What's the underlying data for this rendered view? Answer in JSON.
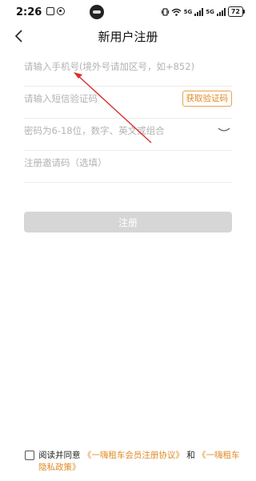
{
  "status_bar": {
    "time": "2:26",
    "network_label_1": "5G",
    "network_label_2": "5G",
    "battery": "72"
  },
  "header": {
    "title": "新用户注册"
  },
  "form": {
    "phone_placeholder": "请输入手机号(境外号请加区号，如+852)",
    "sms_placeholder": "请输入短信验证码",
    "sms_button": "获取验证码",
    "password_placeholder": "密码为6-18位，数字、英文或组合",
    "invite_placeholder": "注册邀请码（选填）"
  },
  "submit": {
    "label": "注册"
  },
  "agreement": {
    "prefix": "阅读并同意",
    "member_agreement": "《一嗨租车会员注册协议》",
    "conjunction": "和",
    "privacy_policy": "《一嗨租车隐私政策》"
  },
  "colors": {
    "accent": "#e08a26",
    "button_disabled": "#d6d6d6",
    "annotation": "#d9302c"
  }
}
